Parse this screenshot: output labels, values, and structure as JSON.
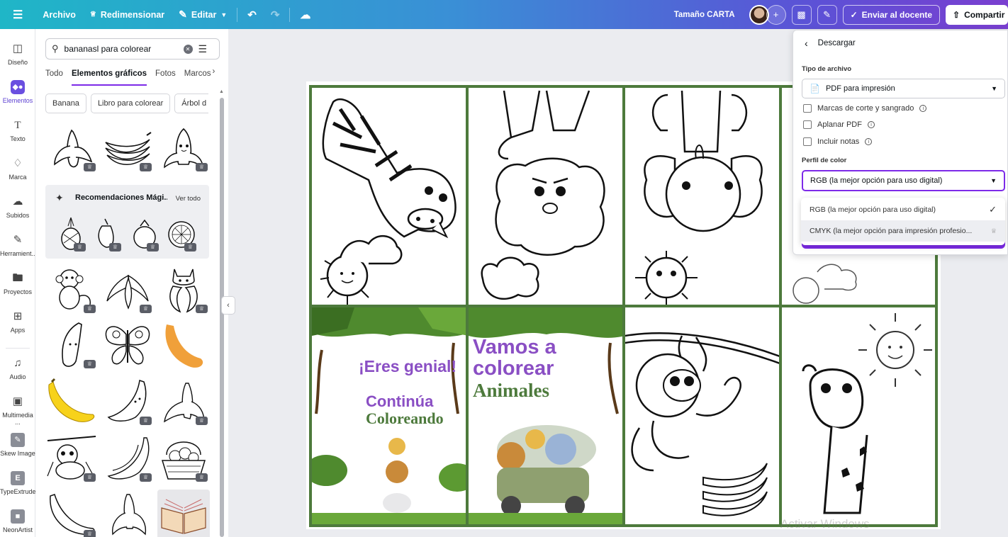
{
  "topbar": {
    "menu_icon": "hamburger-icon",
    "file": "Archivo",
    "resize": "Redimensionar",
    "edit": "Editar",
    "size": "Tamaño CARTA",
    "send": "Enviar al docente",
    "share": "Compartir"
  },
  "rail": [
    {
      "label": "Diseño",
      "icon": "layout-icon"
    },
    {
      "label": "Elementos",
      "icon": "shapes-icon"
    },
    {
      "label": "Texto",
      "icon": "text-icon"
    },
    {
      "label": "Marca",
      "icon": "brand-icon"
    },
    {
      "label": "Subidos",
      "icon": "upload-icon"
    },
    {
      "label": "Herramient...",
      "icon": "draw-icon"
    },
    {
      "label": "Proyectos",
      "icon": "folder-icon"
    },
    {
      "label": "Apps",
      "icon": "apps-icon"
    },
    {
      "label": "Audio",
      "icon": "music-icon"
    },
    {
      "label": "Multimedia ...",
      "icon": "multimedia-icon"
    },
    {
      "label": "Skew Image",
      "icon": "skew-icon"
    },
    {
      "label": "TypeExtrude",
      "icon": "typeextrude-icon"
    },
    {
      "label": "NeonArtist",
      "icon": "neonartist-icon"
    }
  ],
  "panel": {
    "search_value": "bananasl para colorear",
    "tabs": [
      "Todo",
      "Elementos gráficos",
      "Fotos",
      "Marcos"
    ],
    "chips": [
      "Banana",
      "Libro para colorear",
      "Árbol d"
    ],
    "magic_title": "Recomendaciones Mági...",
    "magic_link": "Ver todo"
  },
  "canvas": {
    "cover1_line1": "¡Eres genial!",
    "cover1_line2": "Continúa",
    "cover1_line3": "Coloreando",
    "cover2_line1": "Vamos a",
    "cover2_line2": "colorear",
    "cover2_line3": "Animales",
    "accent_purple": "#8a4fc4",
    "accent_green": "#4d7a3c"
  },
  "download": {
    "title": "Descargar",
    "file_type_label": "Tipo de archivo",
    "file_type_value": "PDF para impresión",
    "crop_marks": "Marcas de corte y sangrado",
    "flatten": "Aplanar PDF",
    "notes": "Incluir notas",
    "color_profile_label": "Perfil de color",
    "color_profile_value": "RGB (la mejor opción para uso digital)",
    "options": [
      "RGB (la mejor opción para uso digital)",
      "CMYK (la mejor opción para impresión profesio..."
    ]
  },
  "watermark": "Activar Windows"
}
